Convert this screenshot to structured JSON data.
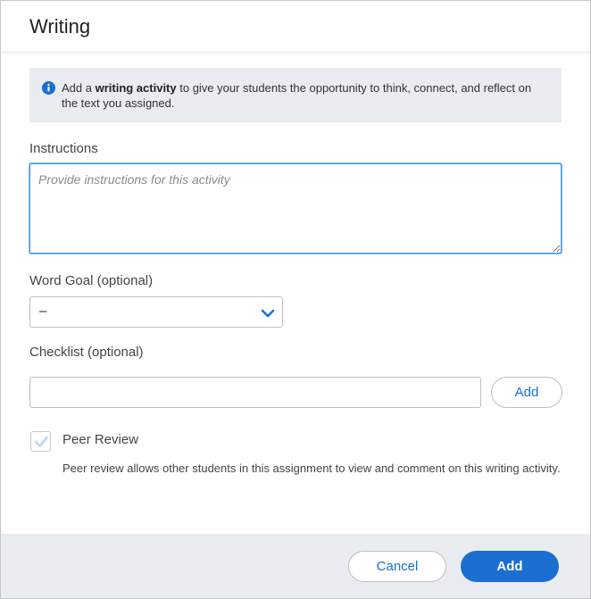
{
  "dialog": {
    "title": "Writing",
    "info": {
      "icon": "info-icon",
      "prefix": "Add a ",
      "bold": "writing activity",
      "suffix": " to give your students the opportunity to think, connect, and reflect on the text you assigned."
    },
    "instructions": {
      "label": "Instructions",
      "placeholder": "Provide instructions for this activity",
      "value": ""
    },
    "word_goal": {
      "label": "Word Goal (optional)",
      "selected": "–",
      "icon": "chevron-down-icon"
    },
    "checklist": {
      "label": "Checklist (optional)",
      "value": "",
      "add_label": "Add"
    },
    "peer_review": {
      "label": "Peer Review",
      "checked": true,
      "description": "Peer review allows other students in this assignment to view and comment on this writing activity."
    },
    "footer": {
      "cancel_label": "Cancel",
      "add_label": "Add"
    }
  },
  "colors": {
    "accent": "#1a6fd0",
    "panel_bg": "#e9ecf1",
    "focus_border": "#4a9be0"
  }
}
